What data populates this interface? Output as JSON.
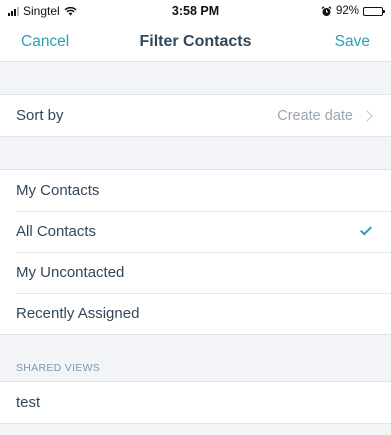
{
  "status_bar": {
    "carrier": "Singtel",
    "time": "3:58 PM",
    "battery": "92%",
    "battery_level": 0.92,
    "icons": [
      "signal-icon",
      "wifi-icon",
      "alarm-icon",
      "battery-icon"
    ]
  },
  "nav": {
    "cancel_label": "Cancel",
    "title": "Filter Contacts",
    "save_label": "Save"
  },
  "sort": {
    "label": "Sort by",
    "value": "Create date"
  },
  "views": [
    {
      "label": "My Contacts",
      "selected": false
    },
    {
      "label": "All Contacts",
      "selected": true
    },
    {
      "label": "My Uncontacted",
      "selected": false
    },
    {
      "label": "Recently Assigned",
      "selected": false
    }
  ],
  "shared_views": {
    "header": "SHARED VIEWS",
    "items": [
      {
        "label": "test"
      }
    ]
  },
  "colors": {
    "accent": "#2b9fb4",
    "background": "#f2f4f7",
    "text": "#33475b",
    "muted": "#9aa5b1"
  }
}
